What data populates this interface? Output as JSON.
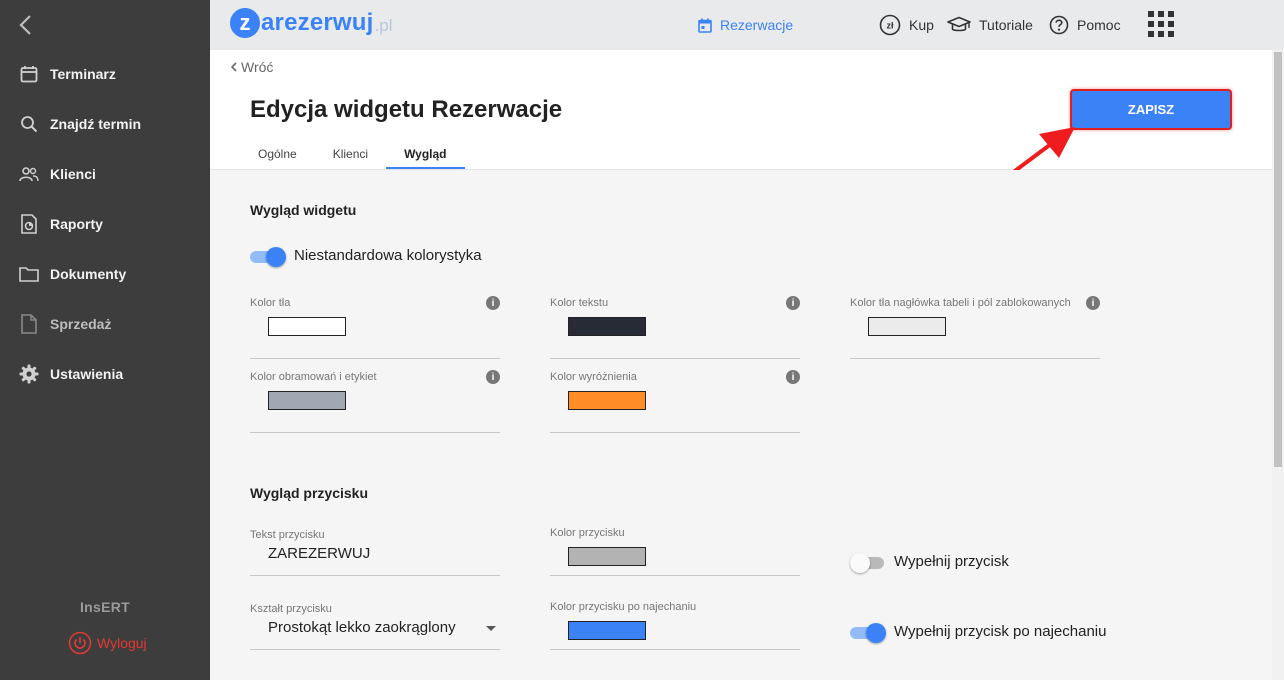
{
  "sidebar": {
    "items": [
      {
        "label": "Terminarz",
        "icon": "calendar-icon"
      },
      {
        "label": "Znajdź termin",
        "icon": "search-icon"
      },
      {
        "label": "Klienci",
        "icon": "people-icon"
      },
      {
        "label": "Raporty",
        "icon": "report-icon"
      },
      {
        "label": "Dokumenty",
        "icon": "folder-icon"
      },
      {
        "label": "Sprzedaż",
        "icon": "document-icon"
      },
      {
        "label": "Ustawienia",
        "icon": "gear-icon"
      }
    ],
    "brand": "InsERT",
    "logout": "Wyloguj"
  },
  "topbar": {
    "logo_z": "z",
    "logo_text": "arezerwuj",
    "logo_tld": ".pl",
    "links": {
      "reservations": "Rezerwacje",
      "buy": "Kup",
      "buy_icon_text": "zł",
      "tutorials": "Tutoriale",
      "help": "Pomoc"
    }
  },
  "header": {
    "back": "Wróć",
    "title": "Edycja widgetu Rezerwacje",
    "tabs": [
      {
        "label": "Ogólne",
        "active": false
      },
      {
        "label": "Klienci",
        "active": false
      },
      {
        "label": "Wygląd",
        "active": true
      }
    ],
    "save": "ZAPISZ"
  },
  "widget_appearance": {
    "title": "Wygląd widgetu",
    "custom_colors_label": "Niestandardowa kolorystyka",
    "custom_colors_on": true,
    "fields": [
      {
        "label": "Kolor tła",
        "color": "#ffffff",
        "info": "i"
      },
      {
        "label": "Kolor tekstu",
        "color": "#272b35",
        "info": "i"
      },
      {
        "label": "Kolor tła nagłówka tabeli i pól zablokowanych",
        "color": "#ebebeb",
        "info": "i"
      },
      {
        "label": "Kolor obramowań i etykiet",
        "color": "#a1a7b3",
        "info": "i"
      },
      {
        "label": "Kolor wyróżnienia",
        "color": "#ff8c26",
        "info": "i"
      }
    ]
  },
  "button_appearance": {
    "title": "Wygląd przycisku",
    "text_label": "Tekst przycisku",
    "text_value": "ZAREZERWUJ",
    "shape_label": "Kształt przycisku",
    "shape_value": "Prostokąt lekko zaokrąglony",
    "color_label": "Kolor przycisku",
    "color": "#b3b3b3",
    "hover_color_label": "Kolor przycisku po najechaniu",
    "hover_color": "#3b82f6",
    "fill_label": "Wypełnij przycisk",
    "fill_on": false,
    "fill_hover_label": "Wypełnij przycisk po najechaniu",
    "fill_hover_on": true
  },
  "colors": {
    "accent": "#3b82f6",
    "sidebar_bg": "#3d3d3d",
    "highlight": "#e02020"
  }
}
